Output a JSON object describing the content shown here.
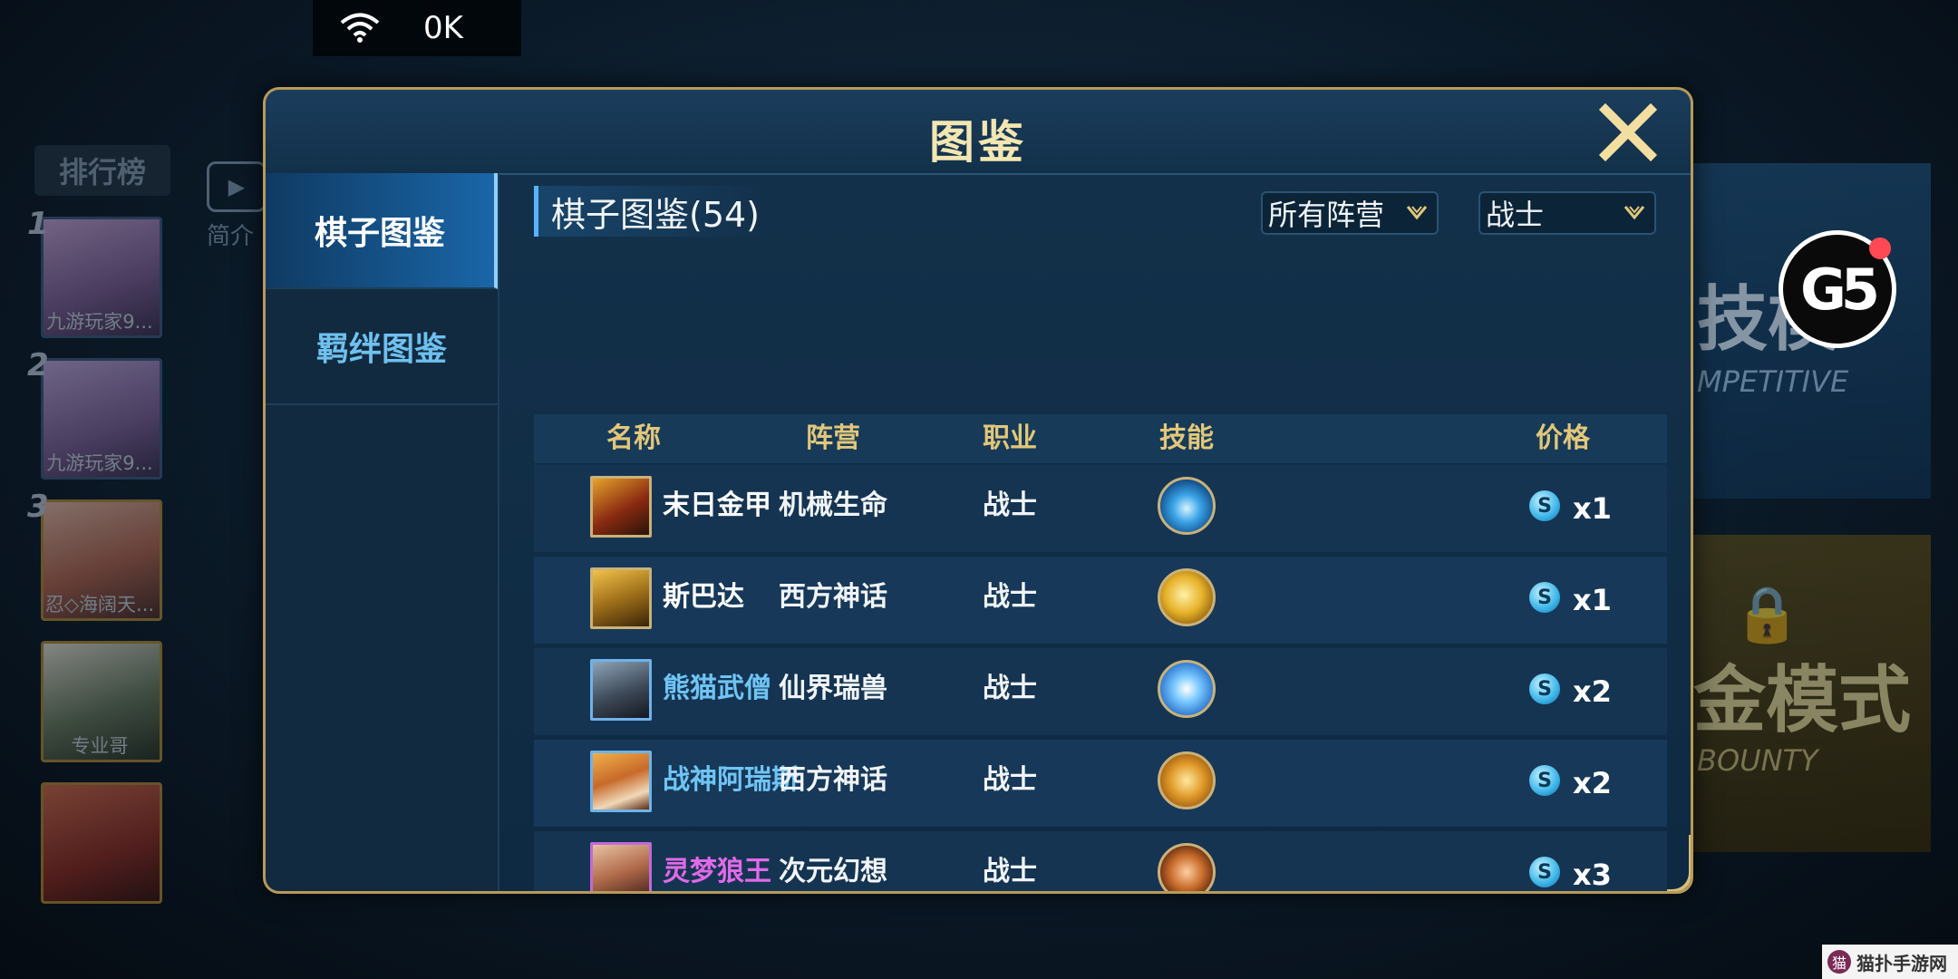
{
  "status_bar": {
    "speed": "0K"
  },
  "background": {
    "leaderboard_title": "排行榜",
    "intro_label": "简介",
    "leaderboard": [
      {
        "rank": "1",
        "name": "九游玩家9..."
      },
      {
        "rank": "2",
        "name": "九游玩家9..."
      },
      {
        "rank": "3",
        "name": "忍◇海阔天..."
      },
      {
        "rank": "",
        "name": "专业哥"
      },
      {
        "rank": "",
        "name": ""
      }
    ],
    "mode_competitive": {
      "title": "技模",
      "subtitle": "MPETITIVE"
    },
    "mode_bounty": {
      "title": "金模式",
      "subtitle": "BOUNTY"
    }
  },
  "dialog": {
    "title": "图鉴",
    "tabs": [
      {
        "label": "棋子图鉴",
        "active": true
      },
      {
        "label": "羁绊图鉴",
        "active": false
      }
    ],
    "section_title": "棋子图鉴(54)",
    "filters": {
      "faction": "所有阵营",
      "class": "战士"
    },
    "columns": {
      "name": "名称",
      "faction": "阵营",
      "class": "职业",
      "skill": "技能",
      "price": "价格"
    },
    "rows": [
      {
        "name": "末日金甲",
        "faction": "机械生命",
        "class": "战士",
        "price": "x1",
        "rarity": "white",
        "portrait": "p-gold",
        "skill": "sk-blue"
      },
      {
        "name": "斯巴达",
        "faction": "西方神话",
        "class": "战士",
        "price": "x1",
        "rarity": "white",
        "portrait": "p-sparta",
        "skill": "sk-gold"
      },
      {
        "name": "熊猫武僧",
        "faction": "仙界瑞兽",
        "class": "战士",
        "price": "x2",
        "rarity": "blue",
        "portrait": "p-panda",
        "skill": "sk-cloud"
      },
      {
        "name": "战神阿瑞斯",
        "faction": "西方神话",
        "class": "战士",
        "price": "x2",
        "rarity": "blue",
        "portrait": "p-ares",
        "skill": "sk-shield"
      },
      {
        "name": "灵梦狼王",
        "faction": "次元幻想",
        "class": "战士",
        "price": "x3",
        "rarity": "purple",
        "portrait": "p-wolf",
        "skill": "sk-claw"
      },
      {
        "name": "",
        "faction": "",
        "class": "",
        "price": "",
        "rarity": "white",
        "portrait": "p-sixth",
        "skill": "sk-fire"
      }
    ]
  },
  "watermark": {
    "text": "猫扑手游网"
  },
  "colors": {
    "accent_gold": "#e2c77a",
    "active_tab": "#1a66a8",
    "rarity_blue": "#6fc4f4",
    "rarity_purple": "#e06ae8"
  }
}
